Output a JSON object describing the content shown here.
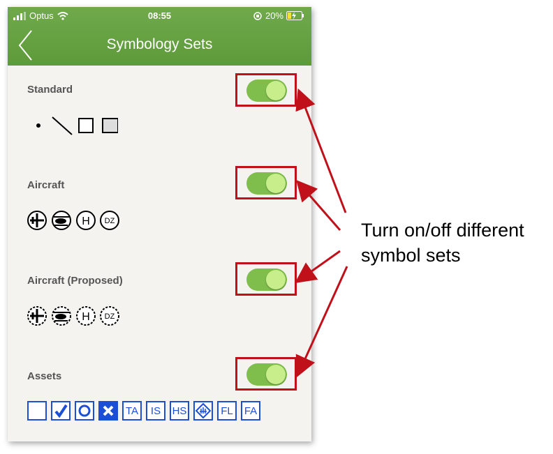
{
  "status": {
    "carrier": "Optus",
    "time": "08:55",
    "battery": "20%"
  },
  "nav": {
    "title": "Symbology Sets"
  },
  "sections": [
    {
      "label": "Standard"
    },
    {
      "label": "Aircraft"
    },
    {
      "label": "Aircraft (Proposed)"
    },
    {
      "label": "Assets"
    }
  ],
  "assets": {
    "labels": [
      "TA",
      "IS",
      "HS",
      "FL",
      "FA"
    ]
  },
  "annotation": {
    "line1": "Turn on/off different",
    "line2": "symbol sets"
  },
  "colors": {
    "nav": "#6fa94b",
    "toggle_on": "#7fbe4c",
    "highlight": "#c0111a",
    "asset": "#1a4fd6"
  }
}
